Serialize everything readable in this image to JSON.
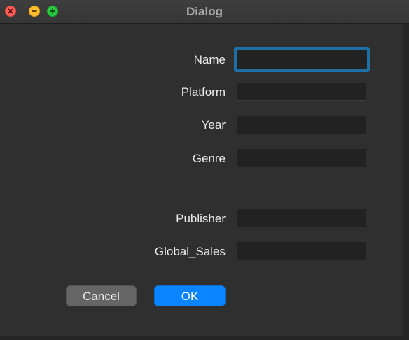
{
  "window": {
    "title": "Dialog"
  },
  "form": {
    "fields": [
      {
        "label": "Name",
        "value": "",
        "focused": true
      },
      {
        "label": "Platform",
        "value": ""
      },
      {
        "label": "Year",
        "value": ""
      },
      {
        "label": "Genre",
        "value": ""
      },
      {
        "label": "Publisher",
        "value": ""
      },
      {
        "label": "Global_Sales",
        "value": ""
      }
    ]
  },
  "buttons": {
    "cancel_label": "Cancel",
    "ok_label": "OK"
  },
  "colors": {
    "background": "#2f2f2f",
    "input_background": "#222222",
    "focus_ring": "#1d6fa5",
    "ok_button": "#0a84ff",
    "cancel_button": "#656565",
    "close_light": "#ff5f57",
    "minimize_light": "#febc2e",
    "maximize_light": "#28c840"
  }
}
